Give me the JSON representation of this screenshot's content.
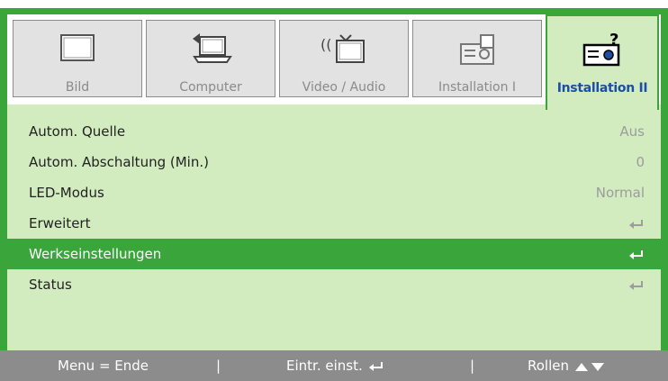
{
  "tabs": [
    {
      "label": "Bild",
      "icon": "monitor-icon",
      "active": false
    },
    {
      "label": "Computer",
      "icon": "computer-icon",
      "active": false
    },
    {
      "label": "Video / Audio",
      "icon": "video-audio-icon",
      "active": false
    },
    {
      "label": "Installation I",
      "icon": "projector-icon",
      "active": false
    },
    {
      "label": "Installation II",
      "icon": "projector-help-icon",
      "active": true
    }
  ],
  "menu": {
    "items": [
      {
        "label": "Autom. Quelle",
        "value": "Aus"
      },
      {
        "label": "Autom. Abschaltung (Min.)",
        "value": "0"
      },
      {
        "label": "LED-Modus",
        "value": "Normal"
      },
      {
        "label": "Erweitert",
        "value": "",
        "icon": "enter-icon"
      },
      {
        "label": "Werkseinstellungen",
        "value": "",
        "icon": "enter-icon",
        "selected": true
      },
      {
        "label": "Status",
        "value": "",
        "icon": "enter-icon"
      }
    ]
  },
  "footer": {
    "menu_hint": "Menu = Ende",
    "sep1": "|",
    "enter_hint": "Eintr. einst.",
    "sep2": "|",
    "scroll_hint": "Rollen"
  },
  "colors": {
    "accent_green": "#3aa53a",
    "panel_bg": "#d2ecbf",
    "active_tab_text": "#1c4fa3",
    "footer_bg": "#8c8c8c"
  }
}
